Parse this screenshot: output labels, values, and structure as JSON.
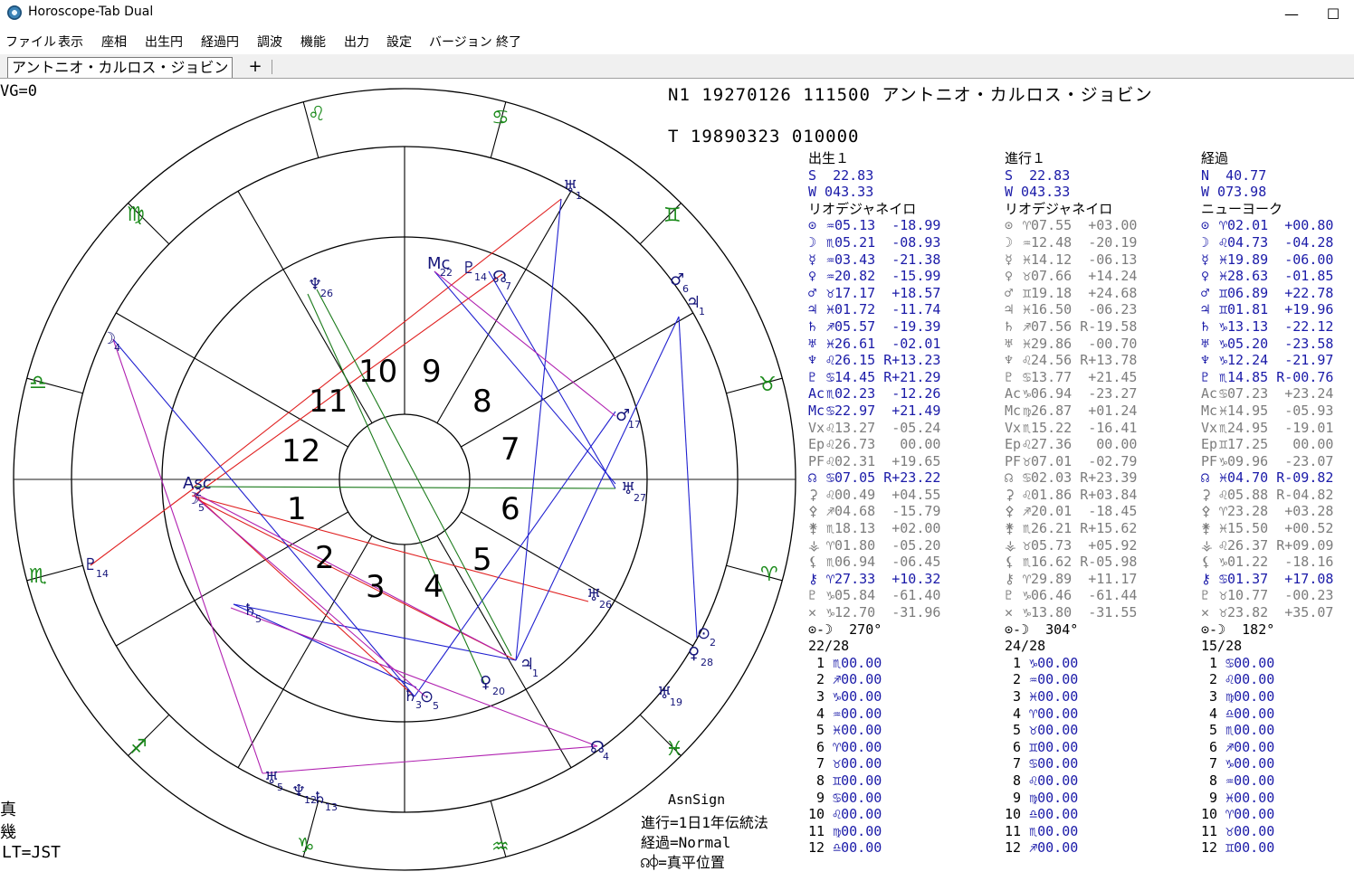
{
  "window": {
    "title": "Horoscope-Tab Dual",
    "minimize": "—",
    "maximize": "☐"
  },
  "menu": [
    "ファイル",
    "表示",
    "座相",
    "出生円",
    "経過円",
    "調波",
    "機能",
    "出力",
    "設定",
    "バージョン",
    "終了"
  ],
  "tabs": {
    "active": "アントニオ・カルロス・ジョビン",
    "add": "+"
  },
  "info": {
    "vg": "VG=0",
    "n1": "N1  19270126  111500   アントニオ・カルロス・ジョビン",
    "t": "T   19890323  010000",
    "left_bottom": [
      "真",
      "幾",
      "LT=JST"
    ],
    "settings": [
      "AsnSign",
      "進行=1日1年伝統法",
      "経過=Normal",
      "☊⌽=真平位置"
    ]
  },
  "wheel": {
    "houses": [
      "1",
      "2",
      "3",
      "4",
      "5",
      "6",
      "7",
      "8",
      "9",
      "10",
      "11",
      "12"
    ],
    "signs_outer": [
      "♌",
      "♋",
      "♊",
      "♉",
      "♈",
      "♓",
      "♒",
      "♑",
      "♐",
      "♏",
      "♎",
      "♍"
    ],
    "planets": [
      {
        "g": "☽",
        "n": "4"
      },
      {
        "g": "♆",
        "n": "26"
      },
      {
        "g": "Mc",
        "n": "22"
      },
      {
        "g": "♇",
        "n": "14"
      },
      {
        "g": "☊",
        "n": "7"
      },
      {
        "g": "♅",
        "n": "1"
      },
      {
        "g": "♂",
        "n": "6"
      },
      {
        "g": "♃",
        "n": "1"
      },
      {
        "g": "♂",
        "n": "17"
      },
      {
        "g": "♅",
        "n": "27"
      },
      {
        "g": "♅",
        "n": "26"
      },
      {
        "g": "⊙",
        "n": "2"
      },
      {
        "g": "♀",
        "n": "28"
      },
      {
        "g": "♃",
        "n": "1"
      },
      {
        "g": "♀",
        "n": "20"
      },
      {
        "g": "♅",
        "n": "19"
      },
      {
        "g": "☊",
        "n": "4"
      },
      {
        "g": "♄",
        "n": "3"
      },
      {
        "g": "⊙",
        "n": "5"
      },
      {
        "g": "♄",
        "n": "5"
      },
      {
        "g": "♅",
        "n": "5"
      },
      {
        "g": "♆",
        "n": "12"
      },
      {
        "g": "♄",
        "n": "13"
      },
      {
        "g": "♇",
        "n": "14"
      },
      {
        "g": "Asc",
        "n": "2"
      },
      {
        "g": "☽",
        "n": "5"
      }
    ]
  },
  "columns": [
    {
      "title": "出生１",
      "lat": "S  22.83",
      "lon": "W 043.33",
      "place": "リオデジャネイロ",
      "rows": [
        {
          "s": "⊙",
          "t": "♒05.13  -18.99",
          "c": "blue"
        },
        {
          "s": "☽",
          "t": "♏05.21  -08.93",
          "c": "blue"
        },
        {
          "s": "☿",
          "t": "♒03.43  -21.38",
          "c": "blue"
        },
        {
          "s": "♀",
          "t": "♒20.82  -15.99",
          "c": "blue"
        },
        {
          "s": "♂",
          "t": "♉17.17  +18.57",
          "c": "blue"
        },
        {
          "s": "♃",
          "t": "♓01.72  -11.74",
          "c": "blue"
        },
        {
          "s": "♄",
          "t": "♐05.57  -19.39",
          "c": "blue"
        },
        {
          "s": "♅",
          "t": "♓26.61  -02.01",
          "c": "blue"
        },
        {
          "s": "♆",
          "t": "♌26.15 R+13.23",
          "c": "blue"
        },
        {
          "s": "♇",
          "t": "♋14.45 R+21.29",
          "c": "blue"
        },
        {
          "s": "Ac",
          "t": "♏02.23  -12.26",
          "c": "blue"
        },
        {
          "s": "Mc",
          "t": "♋22.97  +21.49",
          "c": "blue"
        },
        {
          "s": "Vx",
          "t": "♌13.27  -05.24",
          "c": "gray"
        },
        {
          "s": "Ep",
          "t": "♌26.73   00.00",
          "c": "gray"
        },
        {
          "s": "PF",
          "t": "♌02.31  +19.65",
          "c": "gray"
        },
        {
          "s": "☊",
          "t": "♋07.05 R+23.22",
          "c": "blue"
        },
        {
          "s": "⚳",
          "t": "♌00.49  +04.55",
          "c": "gray"
        },
        {
          "s": "⚴",
          "t": "♐04.68  -15.79",
          "c": "gray"
        },
        {
          "s": "⚵",
          "t": "♏18.13  +02.00",
          "c": "gray"
        },
        {
          "s": "⚶",
          "t": "♈01.80  -05.20",
          "c": "gray"
        },
        {
          "s": "⚸",
          "t": "♏06.94  -06.45",
          "c": "gray"
        },
        {
          "s": "⚷",
          "t": "♈27.33  +10.32",
          "c": "blue"
        },
        {
          "s": "♇",
          "t": "♑05.84  -61.40",
          "c": "gray"
        },
        {
          "s": "✕",
          "t": "♑12.70  -31.96",
          "c": "gray"
        }
      ],
      "phase": "⊙-☽  270°",
      "ratio": "22/28",
      "houses": [
        "♏00.00",
        "♐00.00",
        "♑00.00",
        "♒00.00",
        "♓00.00",
        "♈00.00",
        "♉00.00",
        "♊00.00",
        "♋00.00",
        "♌00.00",
        "♍00.00",
        "♎00.00"
      ]
    },
    {
      "title": "進行１",
      "lat": "S  22.83",
      "lon": "W 043.33",
      "place": "リオデジャネイロ",
      "rows": [
        {
          "s": "⊙",
          "t": "♈07.55  +03.00",
          "c": "gray"
        },
        {
          "s": "☽",
          "t": "♒12.48  -20.19",
          "c": "gray"
        },
        {
          "s": "☿",
          "t": "♓14.12  -06.13",
          "c": "gray"
        },
        {
          "s": "♀",
          "t": "♉07.66  +14.24",
          "c": "gray"
        },
        {
          "s": "♂",
          "t": "♊19.18  +24.68",
          "c": "gray"
        },
        {
          "s": "♃",
          "t": "♓16.50  -06.23",
          "c": "gray"
        },
        {
          "s": "♄",
          "t": "♐07.56 R-19.58",
          "c": "gray"
        },
        {
          "s": "♅",
          "t": "♓29.86  -00.70",
          "c": "gray"
        },
        {
          "s": "♆",
          "t": "♌24.56 R+13.78",
          "c": "gray"
        },
        {
          "s": "♇",
          "t": "♋13.77  +21.45",
          "c": "gray"
        },
        {
          "s": "Ac",
          "t": "♑06.94  -23.27",
          "c": "gray"
        },
        {
          "s": "Mc",
          "t": "♍26.87  +01.24",
          "c": "gray"
        },
        {
          "s": "Vx",
          "t": "♏15.22  -16.41",
          "c": "gray"
        },
        {
          "s": "Ep",
          "t": "♌27.36   00.00",
          "c": "gray"
        },
        {
          "s": "PF",
          "t": "♉07.01  -02.79",
          "c": "gray"
        },
        {
          "s": "☊",
          "t": "♋02.03 R+23.39",
          "c": "gray"
        },
        {
          "s": "⚳",
          "t": "♌01.86 R+03.84",
          "c": "gray"
        },
        {
          "s": "⚴",
          "t": "♐20.01  -18.45",
          "c": "gray"
        },
        {
          "s": "⚵",
          "t": "♏26.21 R+15.62",
          "c": "gray"
        },
        {
          "s": "⚶",
          "t": "♉05.73  +05.92",
          "c": "gray"
        },
        {
          "s": "⚸",
          "t": "♏16.62 R-05.98",
          "c": "gray"
        },
        {
          "s": "⚷",
          "t": "♈29.89  +11.17",
          "c": "gray"
        },
        {
          "s": "♇",
          "t": "♑06.46  -61.44",
          "c": "gray"
        },
        {
          "s": "✕",
          "t": "♑13.80  -31.55",
          "c": "gray"
        }
      ],
      "phase": "⊙-☽  304°",
      "ratio": "24/28",
      "houses": [
        "♑00.00",
        "♒00.00",
        "♓00.00",
        "♈00.00",
        "♉00.00",
        "♊00.00",
        "♋00.00",
        "♌00.00",
        "♍00.00",
        "♎00.00",
        "♏00.00",
        "♐00.00"
      ]
    },
    {
      "title": "経過",
      "lat": "N  40.77",
      "lon": "W 073.98",
      "place": "ニューヨーク",
      "rows": [
        {
          "s": "⊙",
          "t": "♈02.01  +00.80",
          "c": "blue"
        },
        {
          "s": "☽",
          "t": "♌04.73  -04.28",
          "c": "blue"
        },
        {
          "s": "☿",
          "t": "♓19.89  -06.00",
          "c": "blue"
        },
        {
          "s": "♀",
          "t": "♓28.63  -01.85",
          "c": "blue"
        },
        {
          "s": "♂",
          "t": "♊06.89  +22.78",
          "c": "blue"
        },
        {
          "s": "♃",
          "t": "♊01.81  +19.96",
          "c": "blue"
        },
        {
          "s": "♄",
          "t": "♑13.13  -22.12",
          "c": "blue"
        },
        {
          "s": "♅",
          "t": "♑05.20  -23.58",
          "c": "blue"
        },
        {
          "s": "♆",
          "t": "♑12.24  -21.97",
          "c": "blue"
        },
        {
          "s": "♇",
          "t": "♏14.85 R-00.76",
          "c": "blue"
        },
        {
          "s": "Ac",
          "t": "♋07.23  +23.24",
          "c": "gray"
        },
        {
          "s": "Mc",
          "t": "♓14.95  -05.93",
          "c": "gray"
        },
        {
          "s": "Vx",
          "t": "♏24.95  -19.01",
          "c": "gray"
        },
        {
          "s": "Ep",
          "t": "♊17.25   00.00",
          "c": "gray"
        },
        {
          "s": "PF",
          "t": "♑09.96  -23.07",
          "c": "gray"
        },
        {
          "s": "☊",
          "t": "♓04.70 R-09.82",
          "c": "blue"
        },
        {
          "s": "⚳",
          "t": "♌05.88 R-04.82",
          "c": "gray"
        },
        {
          "s": "⚴",
          "t": "♈23.28  +03.28",
          "c": "gray"
        },
        {
          "s": "⚵",
          "t": "♓15.50  +00.52",
          "c": "gray"
        },
        {
          "s": "⚶",
          "t": "♌26.37 R+09.09",
          "c": "gray"
        },
        {
          "s": "⚸",
          "t": "♑01.22  -18.16",
          "c": "gray"
        },
        {
          "s": "⚷",
          "t": "♋01.37  +17.08",
          "c": "blue"
        },
        {
          "s": "♇",
          "t": "♉10.77  -00.23",
          "c": "gray"
        },
        {
          "s": "✕",
          "t": "♉23.82  +35.07",
          "c": "gray"
        }
      ],
      "phase": "⊙-☽  182°",
      "ratio": "15/28",
      "houses": [
        "♋00.00",
        "♌00.00",
        "♍00.00",
        "♎00.00",
        "♏00.00",
        "♐00.00",
        "♑00.00",
        "♒00.00",
        "♓00.00",
        "♈00.00",
        "♉00.00",
        "♊00.00"
      ]
    }
  ]
}
